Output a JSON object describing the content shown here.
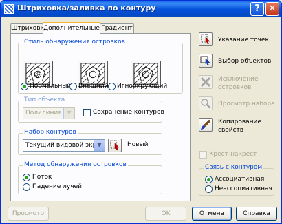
{
  "window": {
    "title": "Штриховка/заливка по контуру",
    "help_label": "?",
    "close_label": "✕"
  },
  "tabs": [
    "Штриховка",
    "Дополнительные",
    "Градиент"
  ],
  "island_style": {
    "label": "Стиль обнаружения островков",
    "options": [
      "Нормальный",
      "Внешний",
      "Игнорирующий"
    ],
    "selected": "Нормальный"
  },
  "object_type": {
    "label": "Тип объекта",
    "value": "Полилиния",
    "retain_label": "Сохранение контуров"
  },
  "boundary_set": {
    "label": "Набор контуров",
    "value": "Текущий видовой экран",
    "new_label": "Новый"
  },
  "island_detection": {
    "label": "Метод обнаружения островков",
    "options": [
      "Поток",
      "Падение лучей"
    ],
    "selected": "Поток"
  },
  "side": {
    "pick_points": "Указание точек",
    "select_objects": "Выбор объектов",
    "remove_islands_1": "Исключение",
    "remove_islands_2": "островков",
    "view_selection": "Просмотр набора",
    "inherit_1": "Копирование",
    "inherit_2": "свойств",
    "double_label": "Крест-накрест"
  },
  "composition": {
    "label": "Связь с контуром",
    "options": [
      "Ассоциативная",
      "Неассоциативная"
    ],
    "selected": "Ассоциативная"
  },
  "buttons": {
    "preview": "Просмотр",
    "ok": "OK",
    "cancel": "Отмена",
    "help": "Справка"
  }
}
